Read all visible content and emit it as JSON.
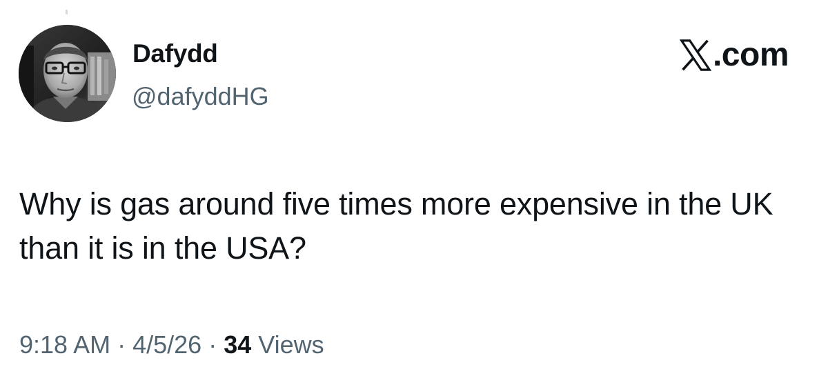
{
  "author": {
    "display_name": "Dafydd",
    "handle": "@dafyddHG",
    "avatar_icon": "profile-photo-avatar"
  },
  "brand": {
    "logo_icon": "x-logo-icon",
    "tld_text": ".com"
  },
  "tweet": {
    "text": "Why is gas around five times more expensive in the UK than it is in the USA?"
  },
  "meta": {
    "time": "9:18 AM",
    "separator": "·",
    "date": "4/5/26",
    "views_count": "34",
    "views_label": "Views"
  },
  "colors": {
    "text_primary": "#0f1419",
    "text_secondary": "#536471",
    "background": "#ffffff"
  }
}
